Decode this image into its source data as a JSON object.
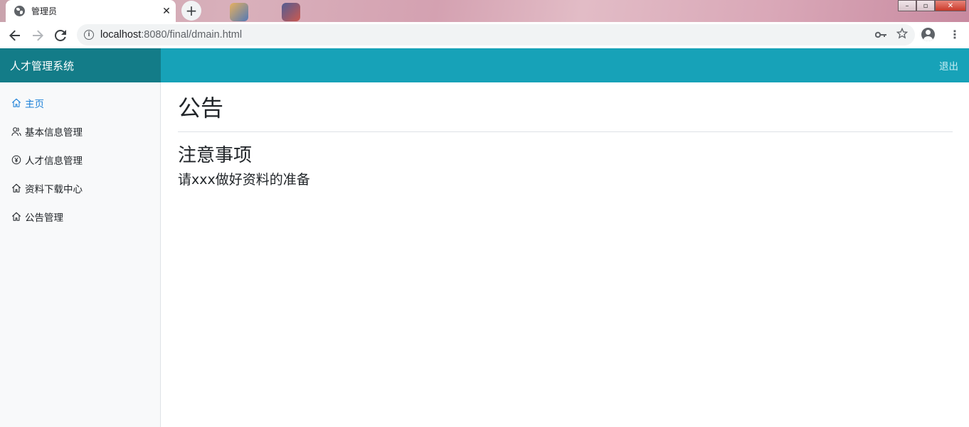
{
  "browser": {
    "tab_title": "管理员",
    "tab_close": "✕",
    "new_tab": "+",
    "url_host": "localhost",
    "url_rest": ":8080/final/dmain.html",
    "window_controls": {
      "minimize": "–",
      "maximize": "▫",
      "close": "✕"
    }
  },
  "app": {
    "brand": "人才管理系统",
    "logout": "退出"
  },
  "sidebar": {
    "items": [
      {
        "label": "主页",
        "icon": "home-icon",
        "active": true
      },
      {
        "label": "基本信息管理",
        "icon": "users-icon",
        "active": false
      },
      {
        "label": "人才信息管理",
        "icon": "yen-circle-icon",
        "active": false
      },
      {
        "label": "资料下载中心",
        "icon": "home-icon",
        "active": false
      },
      {
        "label": "公告管理",
        "icon": "home-icon",
        "active": false
      }
    ]
  },
  "main": {
    "title": "公告",
    "notice_title": "注意事项",
    "notice_body": "请xxx做好资料的准备"
  },
  "colors": {
    "header": "#17a2b8",
    "brand_bg": "#137c88",
    "active_link": "#1a7fd8",
    "sidebar_bg": "#f8f9fa"
  }
}
